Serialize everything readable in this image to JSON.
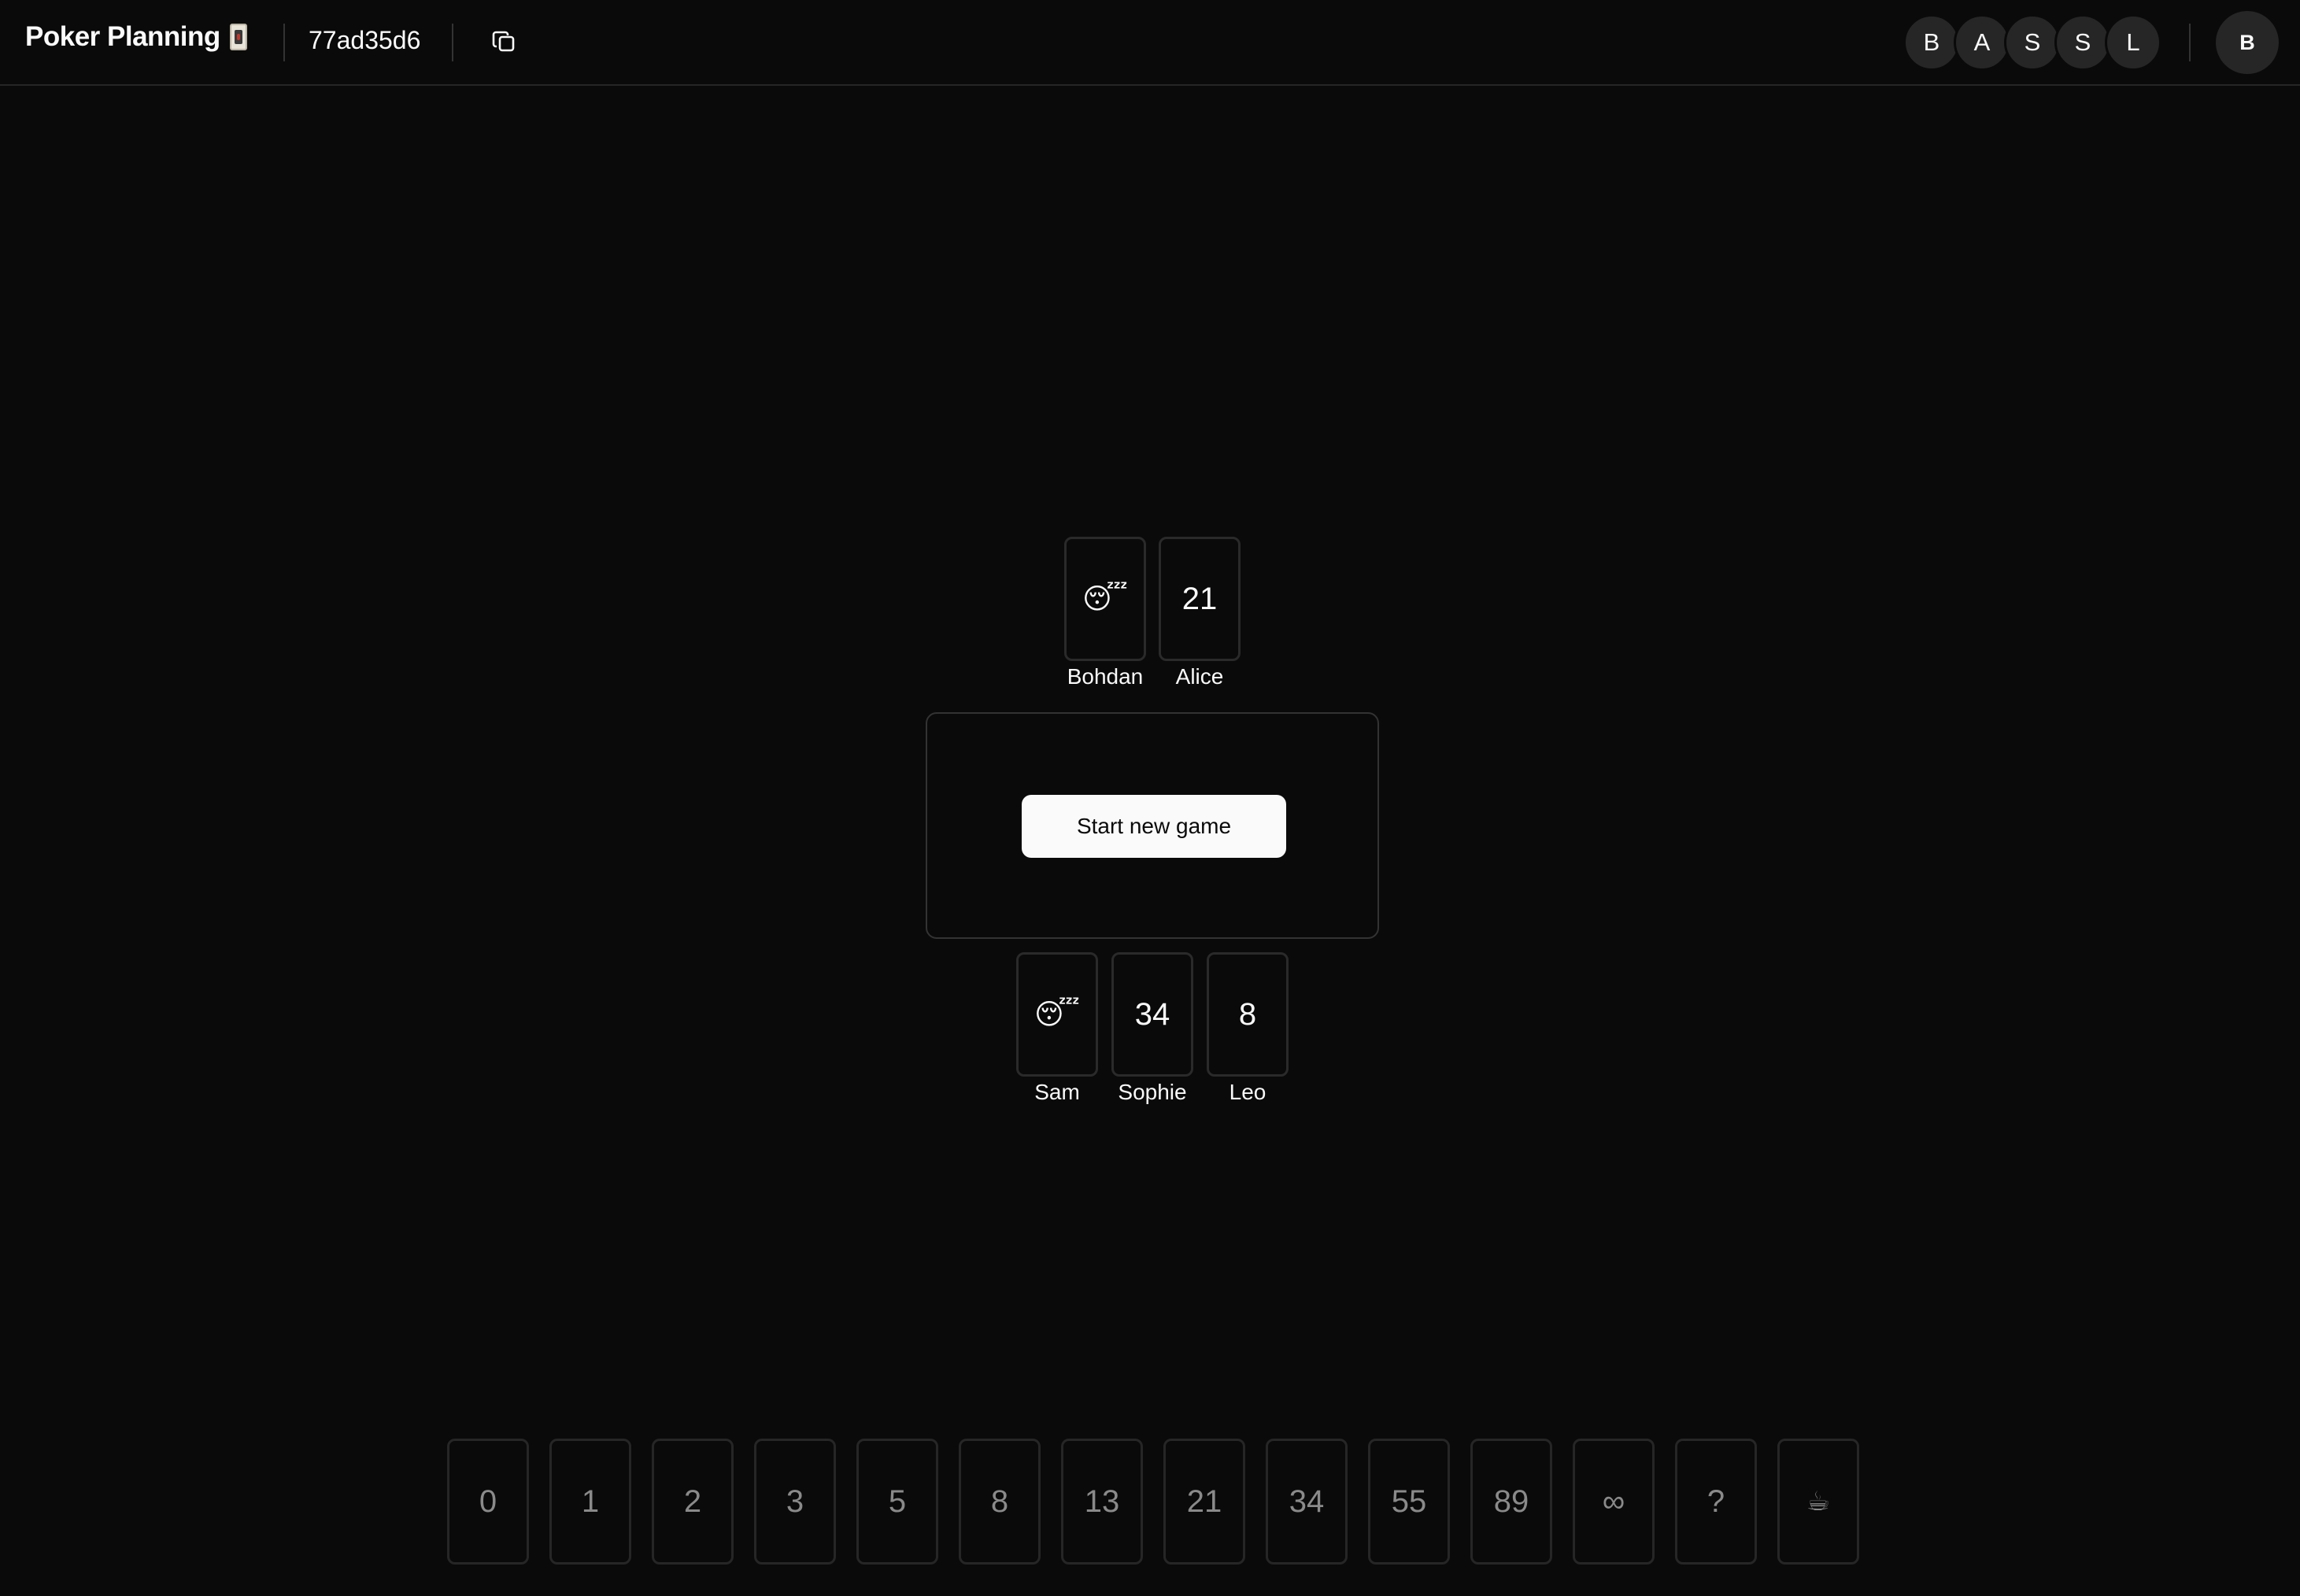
{
  "header": {
    "title": "Poker Planning",
    "title_icon": "playing-card-icon",
    "room_id": "77ad35d6",
    "copy_icon": "copy-icon",
    "participants": [
      "B",
      "A",
      "S",
      "S",
      "L"
    ],
    "current_user": "B"
  },
  "table": {
    "top_players": [
      {
        "name": "Bohdan",
        "card": "😴"
      },
      {
        "name": "Alice",
        "card": "21"
      }
    ],
    "bottom_players": [
      {
        "name": "Sam",
        "card": "😴"
      },
      {
        "name": "Sophie",
        "card": "34"
      },
      {
        "name": "Leo",
        "card": "8"
      }
    ],
    "start_button_label": "Start new game"
  },
  "deck": [
    "0",
    "1",
    "2",
    "3",
    "5",
    "8",
    "13",
    "21",
    "34",
    "55",
    "89",
    "∞",
    "?",
    "☕"
  ],
  "colors": {
    "background": "#0a0a0a",
    "border": "#262626",
    "text": "#fafafa",
    "muted_text": "#8a8a8a",
    "button_bg": "#fafafa"
  }
}
